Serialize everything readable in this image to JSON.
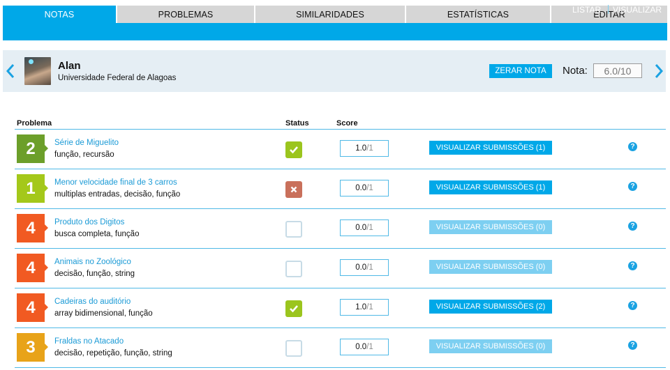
{
  "tabs": [
    {
      "label": "NOTAS",
      "active": true
    },
    {
      "label": "PROBLEMAS",
      "active": false
    },
    {
      "label": "SIMILARIDADES",
      "active": false
    },
    {
      "label": "ESTATÍSTICAS",
      "active": false
    },
    {
      "label": "EDITAR",
      "active": false
    }
  ],
  "subnav": {
    "listar": "LISTAR",
    "visualizar": "VISUALIZAR"
  },
  "user": {
    "name": "Alan",
    "institution": "Universidade Federal de Alagoas",
    "reset_label": "ZERAR NOTA",
    "grade_label": "Nota:",
    "grade_value": "6.0/10"
  },
  "table": {
    "headers": {
      "problem": "Problema",
      "status": "Status",
      "score": "Score"
    },
    "rows": [
      {
        "difficulty": "2",
        "color": "#6c9f2a",
        "name": "Série de Miguelito",
        "tags": "função, recursão",
        "status": "ok",
        "score": "1.0",
        "max": "/1",
        "submissions": "VISUALIZAR SUBMISSÕES (1)",
        "submissions_enabled": true
      },
      {
        "difficulty": "1",
        "color": "#a4c81a",
        "name": "Menor velocidade final de 3 carros",
        "tags": "multiplas entradas, decisão, função",
        "status": "fail",
        "score": "0.0",
        "max": "/1",
        "submissions": "VISUALIZAR SUBMISSÕES (1)",
        "submissions_enabled": true
      },
      {
        "difficulty": "4",
        "color": "#f15a22",
        "name": "Produto dos Digitos",
        "tags": "busca completa, função",
        "status": "none",
        "score": "0.0",
        "max": "/1",
        "submissions": "VISUALIZAR SUBMISSÕES (0)",
        "submissions_enabled": false
      },
      {
        "difficulty": "4",
        "color": "#f15a22",
        "name": "Animais no Zoológico",
        "tags": "decisão, função, string",
        "status": "none",
        "score": "0.0",
        "max": "/1",
        "submissions": "VISUALIZAR SUBMISSÕES (0)",
        "submissions_enabled": false
      },
      {
        "difficulty": "4",
        "color": "#f15a22",
        "name": "Cadeiras do auditório",
        "tags": "array bidimensional, função",
        "status": "ok",
        "score": "1.0",
        "max": "/1",
        "submissions": "VISUALIZAR SUBMISSÕES (2)",
        "submissions_enabled": true
      },
      {
        "difficulty": "3",
        "color": "#e8a319",
        "name": "Fraldas no Atacado",
        "tags": "decisão, repetição, função, string",
        "status": "none",
        "score": "0.0",
        "max": "/1",
        "submissions": "VISUALIZAR SUBMISSÕES (0)",
        "submissions_enabled": false
      }
    ]
  },
  "icons": {
    "prev": "chevron-left-icon",
    "next": "chevron-right-icon",
    "help": "question-icon",
    "check": "check-icon",
    "cross": "cross-icon"
  },
  "colors": {
    "accent": "#00a8e8",
    "panel": "#e5eef4",
    "link": "#1a9ad6"
  }
}
